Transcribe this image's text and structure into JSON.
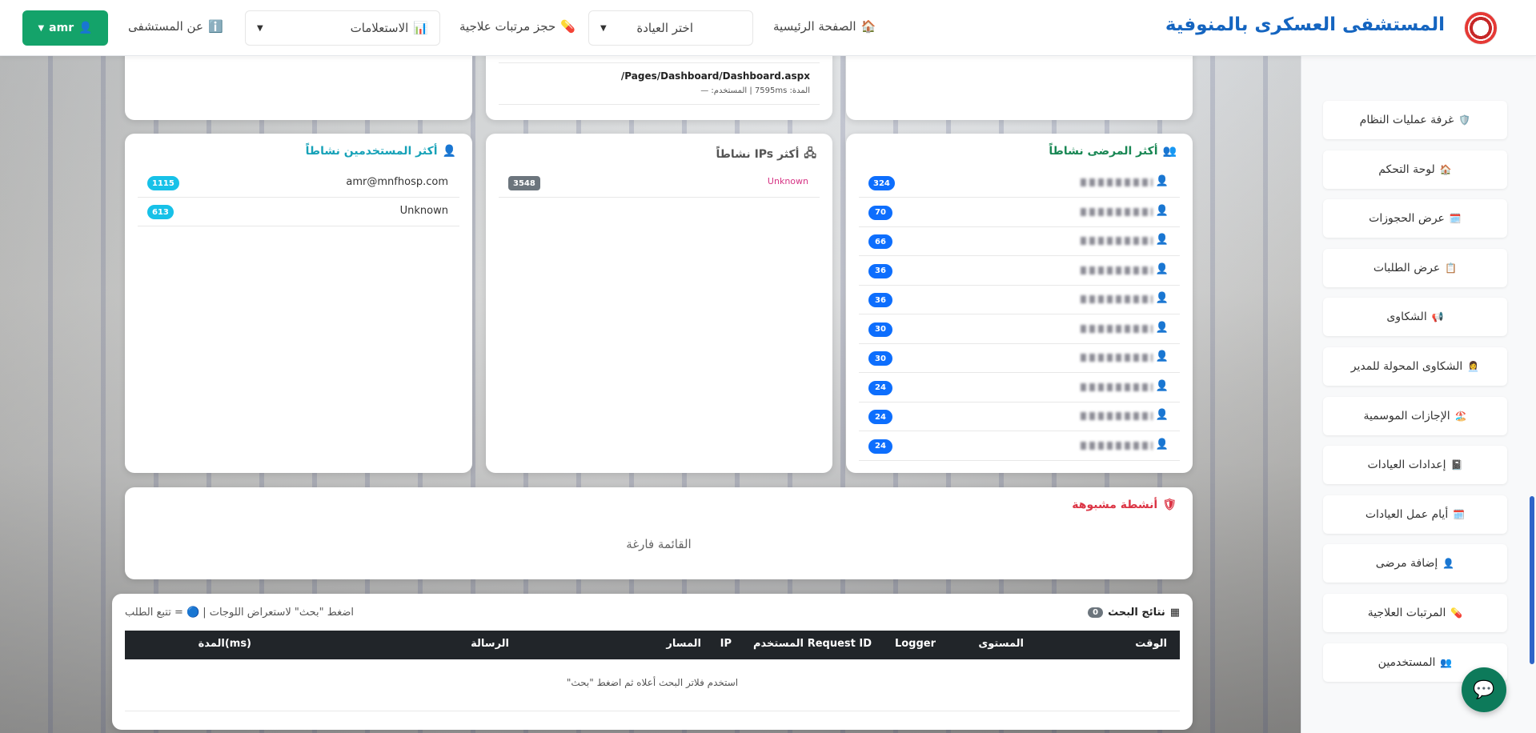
{
  "navbar": {
    "brand": "المستشفى العسكرى بالمنوفية",
    "home": "الصفحة الرئيسية",
    "clinic_select": "اختر العيادة",
    "book": "حجز مرتبات علاجية",
    "inquiries": "الاستعلامات",
    "about": "عن المستشفى",
    "user": "amr",
    "accent": "#14a36a"
  },
  "sidebar": {
    "items": [
      {
        "label": "غرفة عمليات النظام",
        "icon": "🛡️"
      },
      {
        "label": "لوحة التحكم",
        "icon": "🏠"
      },
      {
        "label": "عرض الحجوزات",
        "icon": "🗓️"
      },
      {
        "label": "عرض الطلبات",
        "icon": "📋"
      },
      {
        "label": "الشكاوى",
        "icon": "📢"
      },
      {
        "label": "الشكاوى المحولة للمدير",
        "icon": "👩‍💼"
      },
      {
        "label": "الإجازات الموسمية",
        "icon": "🏖️"
      },
      {
        "label": "إعدادات العيادات",
        "icon": "📓"
      },
      {
        "label": "أيام عمل العيادات",
        "icon": "🗓️"
      },
      {
        "label": "إضافة مرضى",
        "icon": "👤"
      },
      {
        "label": "المرتبات العلاجية",
        "icon": "💊"
      },
      {
        "label": "المستخدمين",
        "icon": "👥"
      }
    ]
  },
  "top_card": {
    "path": "/Pages/Dashboard/Dashboard.aspx",
    "meta": "المدة: 7595ms | المستخدم: —"
  },
  "patients": {
    "title": "أكثر المرضى نشاطاً",
    "counts": [
      "324",
      "70",
      "66",
      "36",
      "36",
      "30",
      "30",
      "24",
      "24",
      "24"
    ]
  },
  "ips": {
    "title": "أكثر IPs نشاطاً",
    "rows": [
      {
        "label": "Unknown",
        "count": "3548"
      }
    ]
  },
  "users": {
    "title": "أكثر المستخدمين نشاطاً",
    "rows": [
      {
        "label": "amr@mnfhosp.com",
        "count": "1115"
      },
      {
        "label": "Unknown",
        "count": "613"
      }
    ]
  },
  "suspicious": {
    "title": "أنشطة مشبوهة",
    "empty": "القائمة فارغة"
  },
  "results": {
    "title": "نتائج البحث",
    "count": "0",
    "hint": "اضغط \"بحث\" لاستعراض اللوجات | 🔵 = تتبع الطلب",
    "columns": [
      "الوقت",
      "المستوى",
      "Logger",
      "Request ID",
      "المستخدم",
      "IP",
      "المسار",
      "الرسالة",
      "المدة(ms)"
    ],
    "empty": "استخدم فلاتر البحث أعلاه ثم اضغط \"بحث\""
  }
}
